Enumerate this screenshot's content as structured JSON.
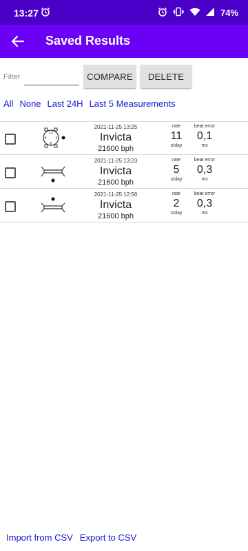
{
  "status_bar": {
    "time": "13:27",
    "battery": "74%"
  },
  "app_bar": {
    "title": "Saved Results"
  },
  "filter": {
    "label": "Filter",
    "value": ""
  },
  "buttons": {
    "compare": "COMPARE",
    "delete": "DELETE"
  },
  "quick_select": [
    "All",
    "None",
    "Last 24H",
    "Last 5 Measurements"
  ],
  "columns": {
    "rate_label": "rate",
    "rate_unit": "s/day",
    "beat_label": "beat error",
    "beat_unit": "ms"
  },
  "results": [
    {
      "date": "2021-11-25 13:25",
      "name": "Invicta",
      "bph": "21600 bph",
      "rate": "11",
      "beat_error": "0,1",
      "position_icon": "dial-up-icon",
      "checked": false
    },
    {
      "date": "2021-11-25 13:23",
      "name": "Invicta",
      "bph": "21600 bph",
      "rate": "5",
      "beat_error": "0,3",
      "position_icon": "crown-down-icon",
      "checked": false
    },
    {
      "date": "2021-11-25 12:56",
      "name": "Invicta",
      "bph": "21600 bph",
      "rate": "2",
      "beat_error": "0,3",
      "position_icon": "crown-up-icon",
      "checked": false
    }
  ],
  "footer": {
    "import": "Import from CSV",
    "export": "Export to CSV"
  },
  "colors": {
    "status_bar": "#4a00c8",
    "app_bar": "#6a00f4",
    "link": "#1515d8"
  }
}
